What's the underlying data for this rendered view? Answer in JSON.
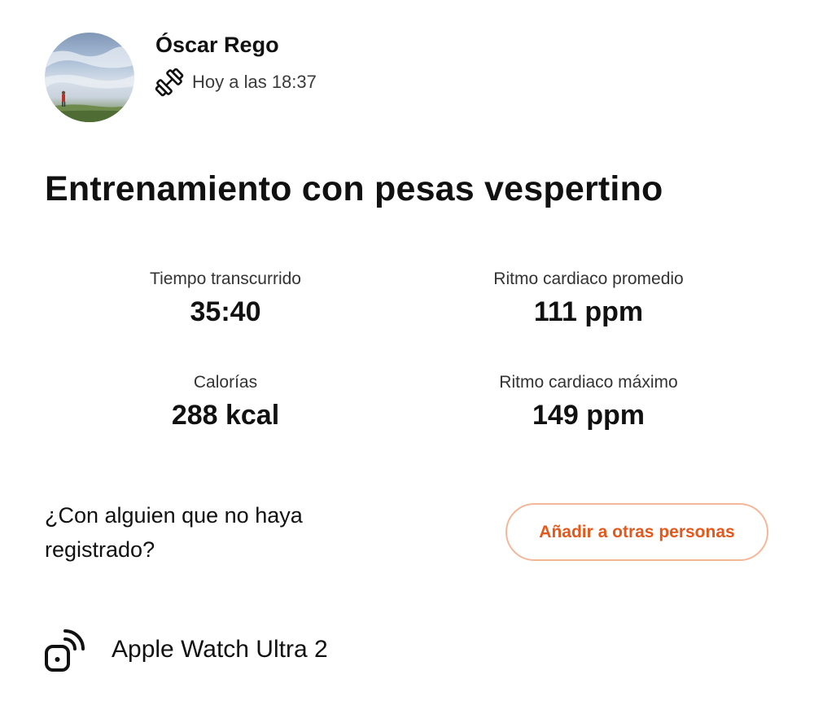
{
  "header": {
    "athlete_name": "Óscar Rego",
    "activity_icon": "dumbbell-icon",
    "timestamp": "Hoy a las 18:37"
  },
  "activity": {
    "title": "Entrenamiento con pesas vespertino"
  },
  "stats": [
    {
      "label": "Tiempo transcurrido",
      "value": "35:40"
    },
    {
      "label": "Ritmo cardiaco promedio",
      "value": "111 ppm"
    },
    {
      "label": "Calorías",
      "value": "288 kcal"
    },
    {
      "label": "Ritmo cardiaco máximo",
      "value": "149 ppm"
    }
  ],
  "group": {
    "prompt": "¿Con alguien que no haya registrado?",
    "add_button_label": "Añadir a otras personas"
  },
  "device": {
    "icon": "watch-signal-icon",
    "name": "Apple Watch Ultra 2"
  },
  "colors": {
    "accent": "#e5581b",
    "button_border": "#f4b79a",
    "text": "#111111",
    "secondary_text": "#333333"
  }
}
